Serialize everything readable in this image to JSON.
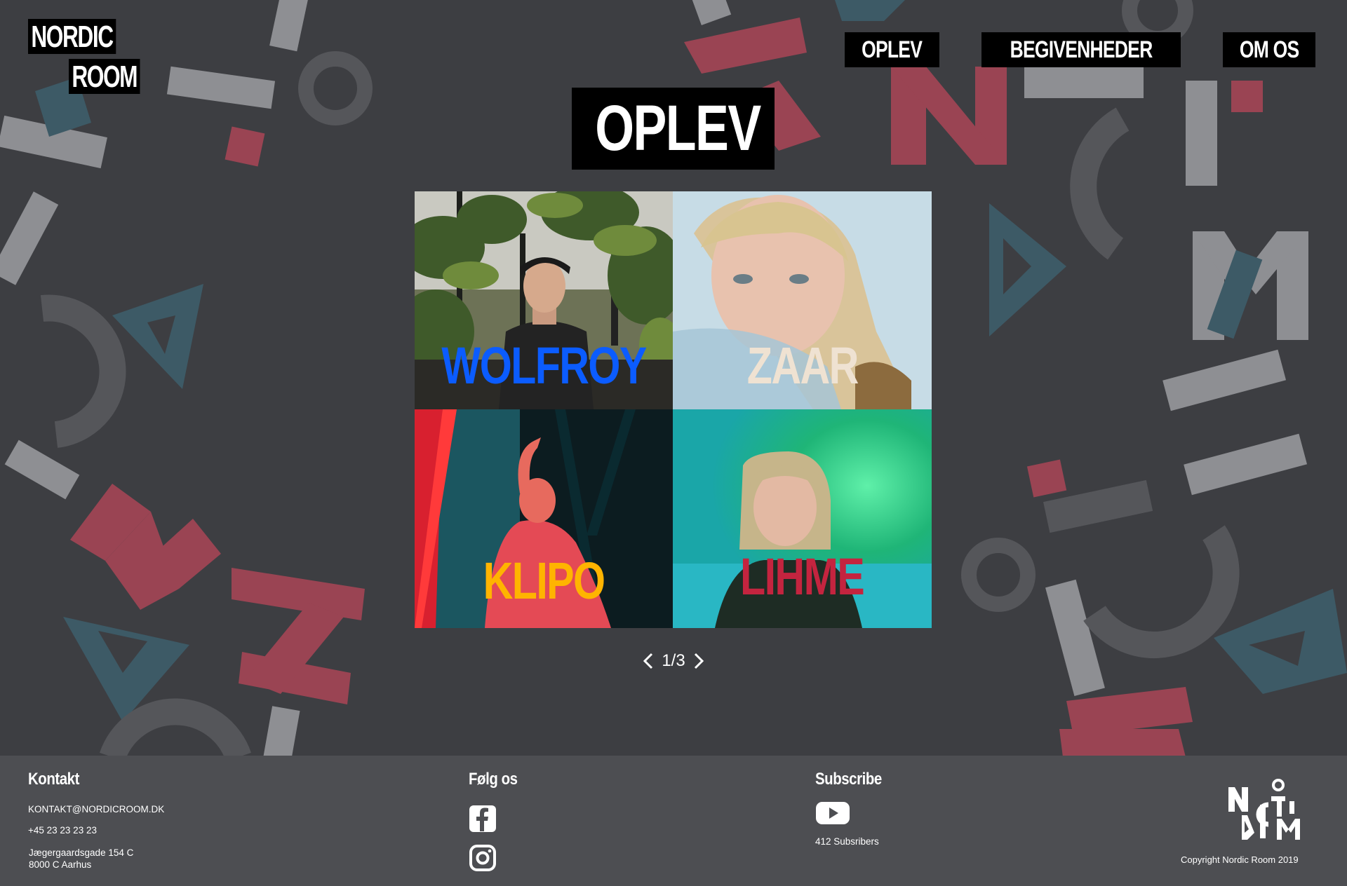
{
  "brand": {
    "logo_line1": "NORDIC",
    "logo_line2": "ROOM"
  },
  "nav": {
    "items": [
      "OPLEV",
      "BEGIVENHEDER",
      "OM OS"
    ]
  },
  "main": {
    "title": "OPLEV",
    "artists": [
      {
        "name": "WOLFROY",
        "color": "#0b5cff"
      },
      {
        "name": "ZAAR",
        "color": "#efe2d2"
      },
      {
        "name": "KLIPO",
        "color": "#ffb400"
      },
      {
        "name": "LIHME",
        "color": "#c4243f"
      }
    ],
    "pager": {
      "current": 1,
      "total": 3,
      "label": "1/3"
    }
  },
  "footer": {
    "contact": {
      "heading": "Kontakt",
      "email": "KONTAKT@NORDICROOM.DK",
      "phone": "+45 23 23 23 23",
      "address_line1": "Jægergaardsgade 154 C",
      "address_line2": "8000 C Aarhus"
    },
    "follow": {
      "heading": "Følg os",
      "icons": [
        "facebook-icon",
        "instagram-icon"
      ]
    },
    "subscribe": {
      "heading": "Subscribe",
      "icon": "youtube-icon",
      "subscribers": "412 Subsribers"
    },
    "copyright": "Copyright Nordic Room 2019"
  },
  "colors": {
    "background": "#3d3e42",
    "footer": "#4d4e52",
    "pattern_red": "#9a4453",
    "pattern_teal": "#3d5a66",
    "pattern_grey": "#8e8f93",
    "pattern_dark": "#55565a"
  }
}
